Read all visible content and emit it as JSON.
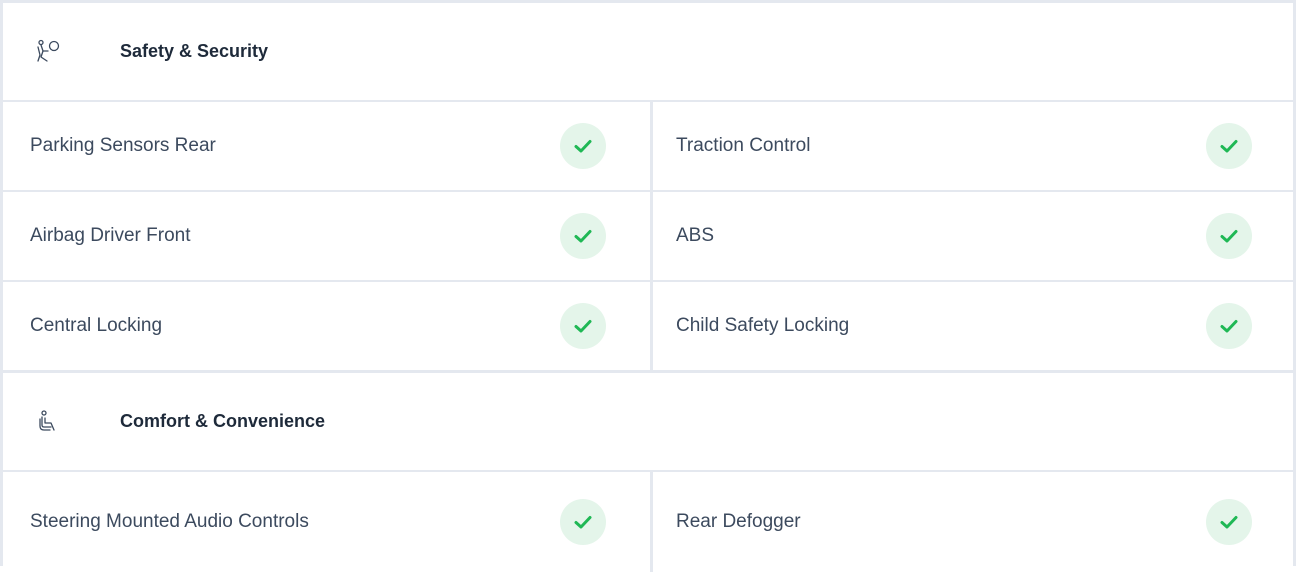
{
  "sections": [
    {
      "title": "Safety & Security",
      "icon": "airbag-icon",
      "rows": [
        [
          {
            "label": "Parking Sensors Rear",
            "available": true
          },
          {
            "label": "Traction Control",
            "available": true
          }
        ],
        [
          {
            "label": "Airbag Driver Front",
            "available": true
          },
          {
            "label": "ABS",
            "available": true
          }
        ],
        [
          {
            "label": "Central Locking",
            "available": true
          },
          {
            "label": "Child Safety Locking",
            "available": true
          }
        ]
      ]
    },
    {
      "title": "Comfort & Convenience",
      "icon": "car-seat-icon",
      "rows": [
        [
          {
            "label": "Steering Mounted Audio Controls",
            "available": true
          },
          {
            "label": "Rear Defogger",
            "available": true
          }
        ]
      ]
    }
  ],
  "colors": {
    "check": "#1fb855",
    "check_bg": "#e4f5ea",
    "border": "#e4e8ef",
    "text": "#3c4a5e",
    "heading": "#1e2a3a"
  }
}
